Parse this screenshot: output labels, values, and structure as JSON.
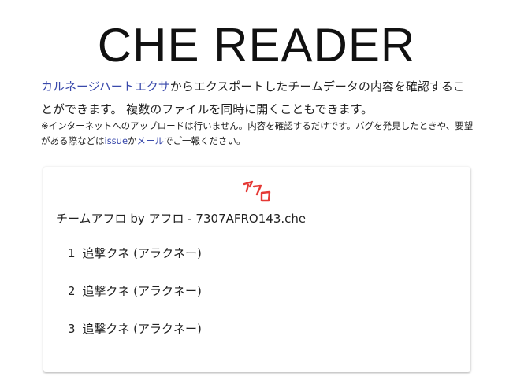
{
  "title": "CHE READER",
  "intro": {
    "link_text": "カルネージハートエクサ",
    "text_after": "からエクスポートしたチームデータの内容を確認することができます。 複数のファイルを同時に開くこともできます。"
  },
  "note": {
    "prefix": "※インターネットへのアップロードは行いません。内容を確認するだけです。バグを発見したときや、要望がある際などは",
    "issue_link": "issue",
    "middle": "か",
    "mail_link": "メール",
    "suffix": "でご一報ください。"
  },
  "colors": {
    "link": "#3949ab",
    "logo": "#e53935"
  },
  "card": {
    "logo_text": "アフロ",
    "logo_icon": "handwritten-red-afro-logo",
    "team_title": "チームアフロ by アフロ - 7307AFRO143.che",
    "members": [
      {
        "num": "1",
        "label": "追撃クネ (アラクネー)"
      },
      {
        "num": "2",
        "label": "追撃クネ (アラクネー)"
      },
      {
        "num": "3",
        "label": "追撃クネ (アラクネー)"
      }
    ]
  }
}
